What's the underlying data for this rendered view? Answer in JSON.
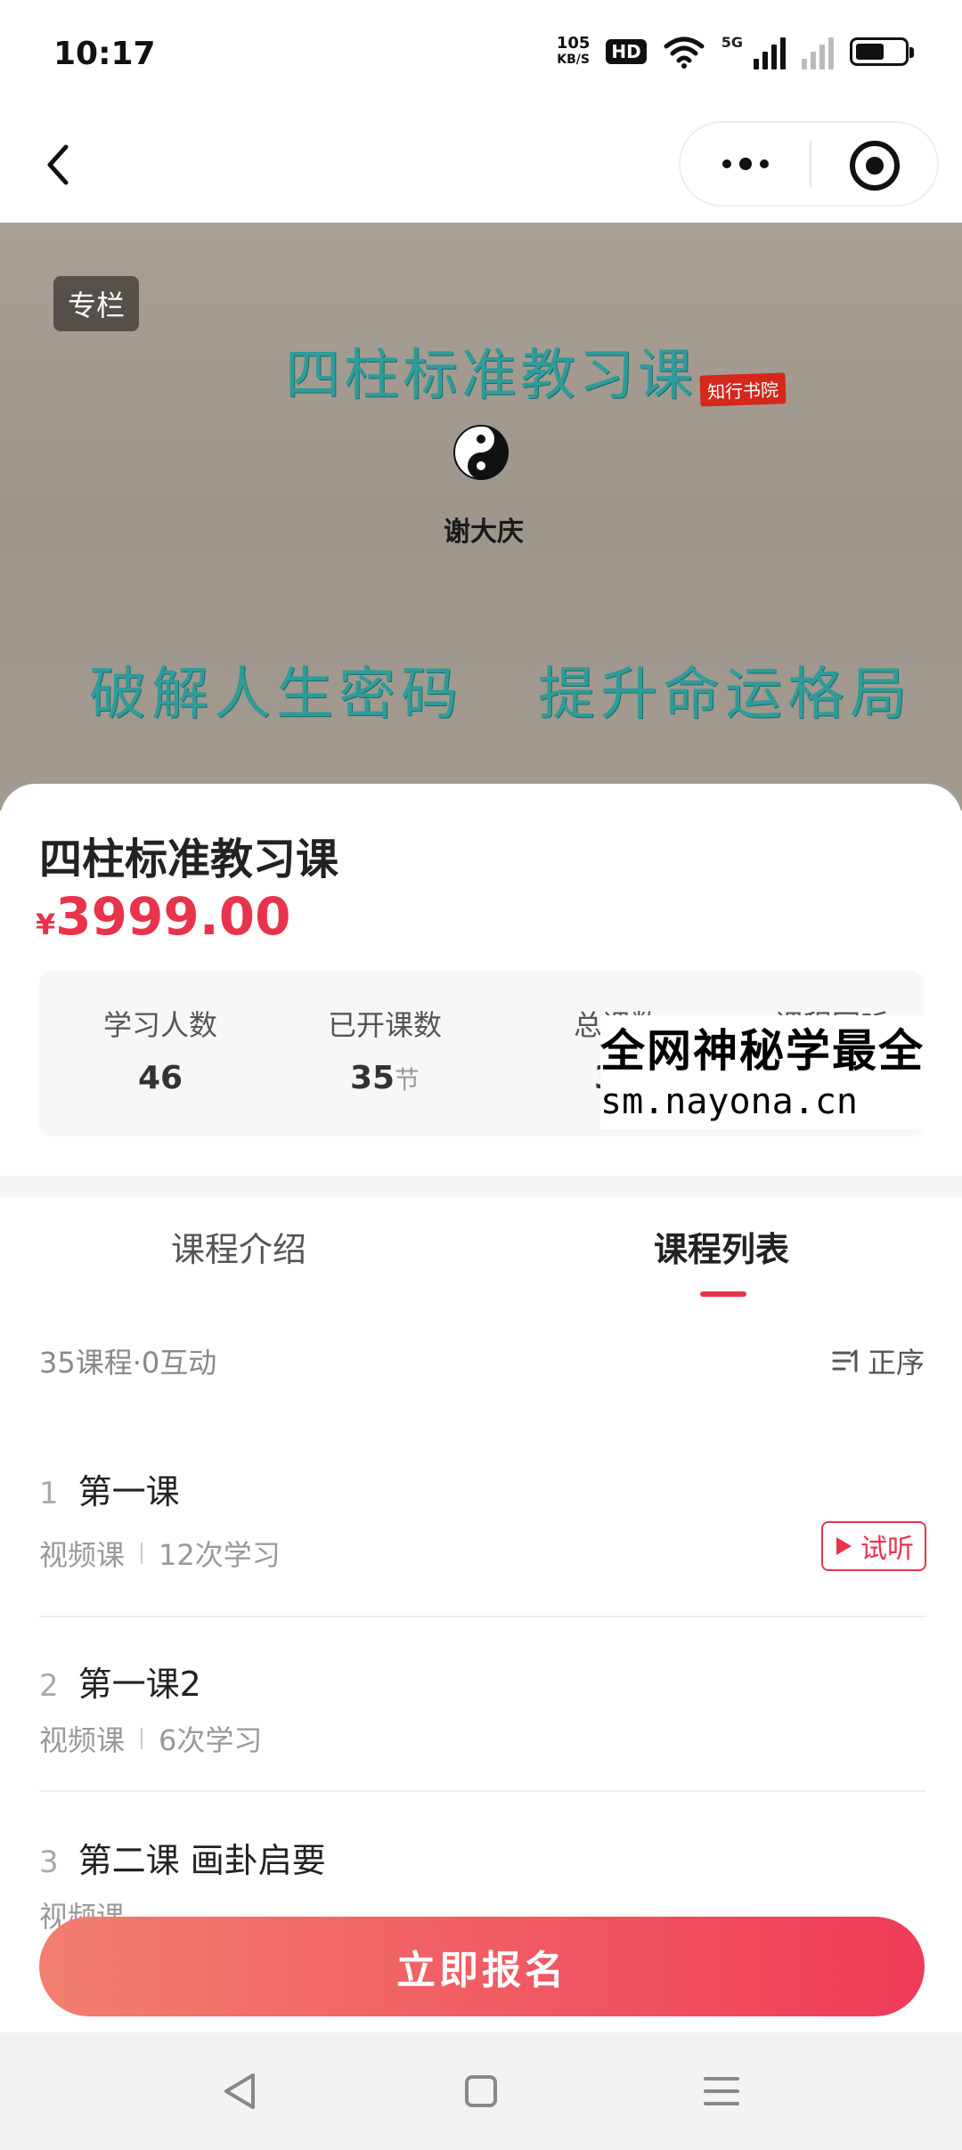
{
  "status_bar": {
    "time": "10:17",
    "net_speed_value": "105",
    "net_speed_unit": "KB/S",
    "hd_label": "HD",
    "network_gen": "5G"
  },
  "banner": {
    "tag": "专栏",
    "title": "四柱标准教习课",
    "seal": "知行书院",
    "author": "谢大庆",
    "slogan_left": "破解人生密码",
    "slogan_right": "提升命运格局"
  },
  "course": {
    "title": "四柱标准教习课",
    "price_symbol": "¥",
    "price": "3999.00",
    "stats": [
      {
        "label": "学习人数",
        "value": "46",
        "unit": ""
      },
      {
        "label": "已开课数",
        "value": "35",
        "unit": "节"
      },
      {
        "label": "总课数",
        "value": "35",
        "unit": ""
      },
      {
        "label": "课程回听",
        "value": "",
        "unit": ""
      }
    ]
  },
  "watermark": {
    "line1": "全网神秘学最全",
    "line2": "sm.nayona.cn"
  },
  "tabs": [
    {
      "label": "课程介绍",
      "active": false
    },
    {
      "label": "课程列表",
      "active": true
    }
  ],
  "list": {
    "meta": "35课程·0互动",
    "sort_label": "正序",
    "lessons": [
      {
        "index": "1",
        "title": "第一课",
        "type": "视频课",
        "views": "12次学习",
        "trial": "试听"
      },
      {
        "index": "2",
        "title": "第一课2",
        "type": "视频课",
        "views": "6次学习"
      },
      {
        "index": "3",
        "title": "第二课 画卦启要",
        "type": "视频课",
        "views": ""
      }
    ]
  },
  "cta": {
    "label": "立即报名"
  },
  "colors": {
    "accent": "#e8344a",
    "banner_text": "#2e9c9a"
  }
}
